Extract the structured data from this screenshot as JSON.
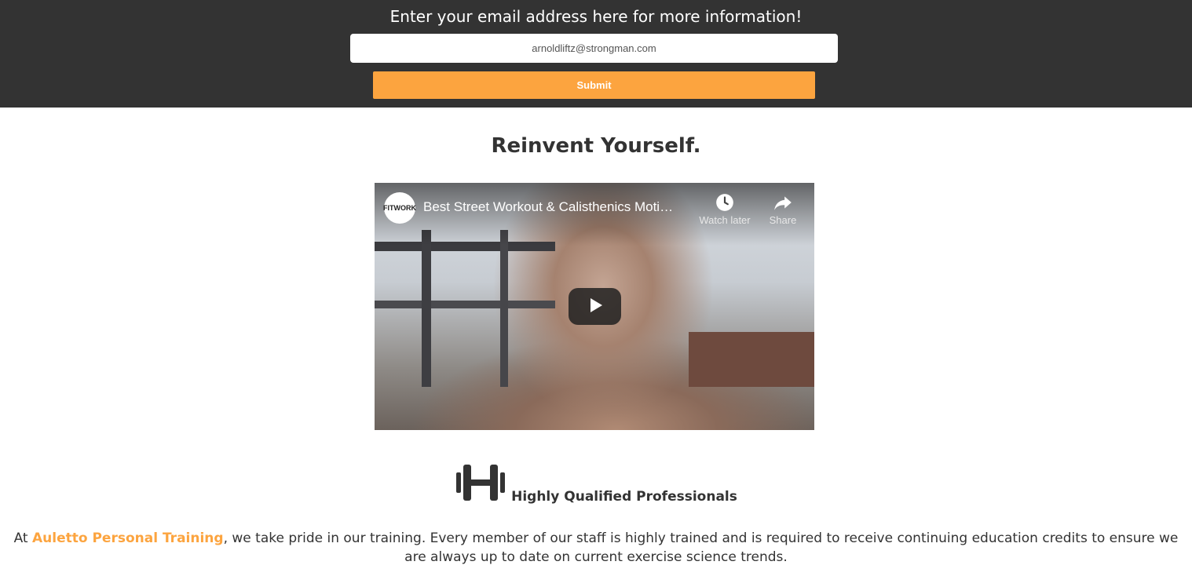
{
  "signup": {
    "title": "Enter your email address here for more information!",
    "email_placeholder": "arnoldliftz@strongman.com",
    "submit_label": "Submit"
  },
  "main": {
    "headline": "Reinvent Yourself."
  },
  "video": {
    "title": "Best Street Workout & Calisthenics Moti…",
    "channel_logo_text": "FITWORK",
    "watch_later_label": "Watch later",
    "share_label": "Share",
    "icons": [
      "clock-icon",
      "share-arrow-icon",
      "play-icon"
    ]
  },
  "feature": {
    "icon": "dumbbell-icon",
    "title": "Highly Qualified Professionals",
    "intro_prefix": "At ",
    "brand": "Auletto Personal Training",
    "intro_suffix": ", we take pride in our training. Every member of our staff is highly trained and is required to receive continuing education credits to ensure we are always up to date on current exercise science trends."
  },
  "colors": {
    "header_bg": "#333333",
    "accent": "#fca43f",
    "text": "#333333"
  }
}
